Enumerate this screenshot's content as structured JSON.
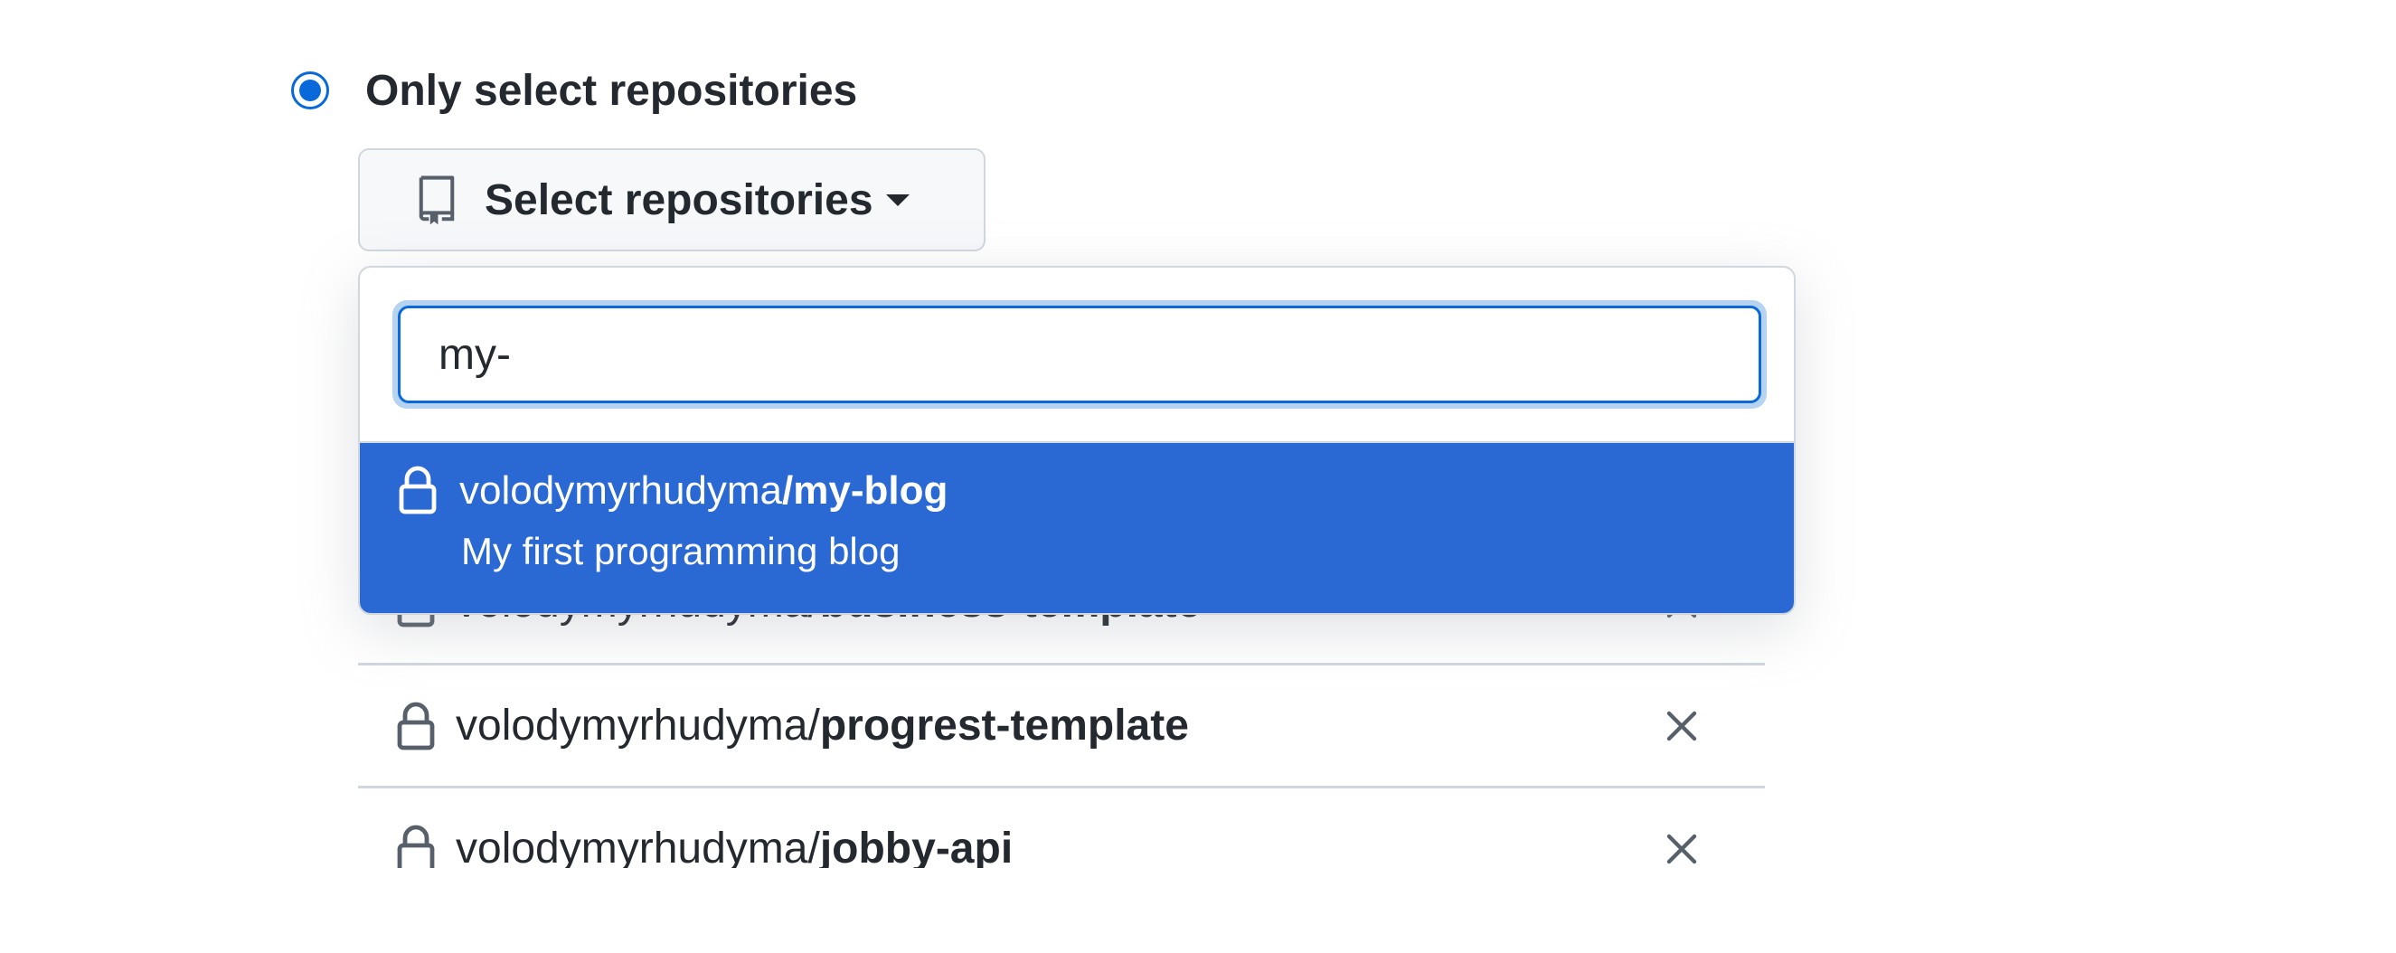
{
  "access": {
    "option_label": "Only select repositories",
    "selected": true
  },
  "select_button": {
    "label": "Select repositories",
    "icon": "repo-icon"
  },
  "search": {
    "value": "my-"
  },
  "suggestion": {
    "owner": "volodymyrhudyma",
    "repo": "/my-blog",
    "description": "My first programming blog",
    "icon": "lock-icon"
  },
  "selected_repos": [
    {
      "owner": "volodymyrhudyma/",
      "repo": "business-template"
    },
    {
      "owner": "volodymyrhudyma/",
      "repo": "progrest-template"
    },
    {
      "owner": "volodymyrhudyma/",
      "repo": "jobby-api"
    }
  ],
  "colors": {
    "accent": "#0969da",
    "highlight": "#2a69d3",
    "border": "#d0d7de"
  }
}
